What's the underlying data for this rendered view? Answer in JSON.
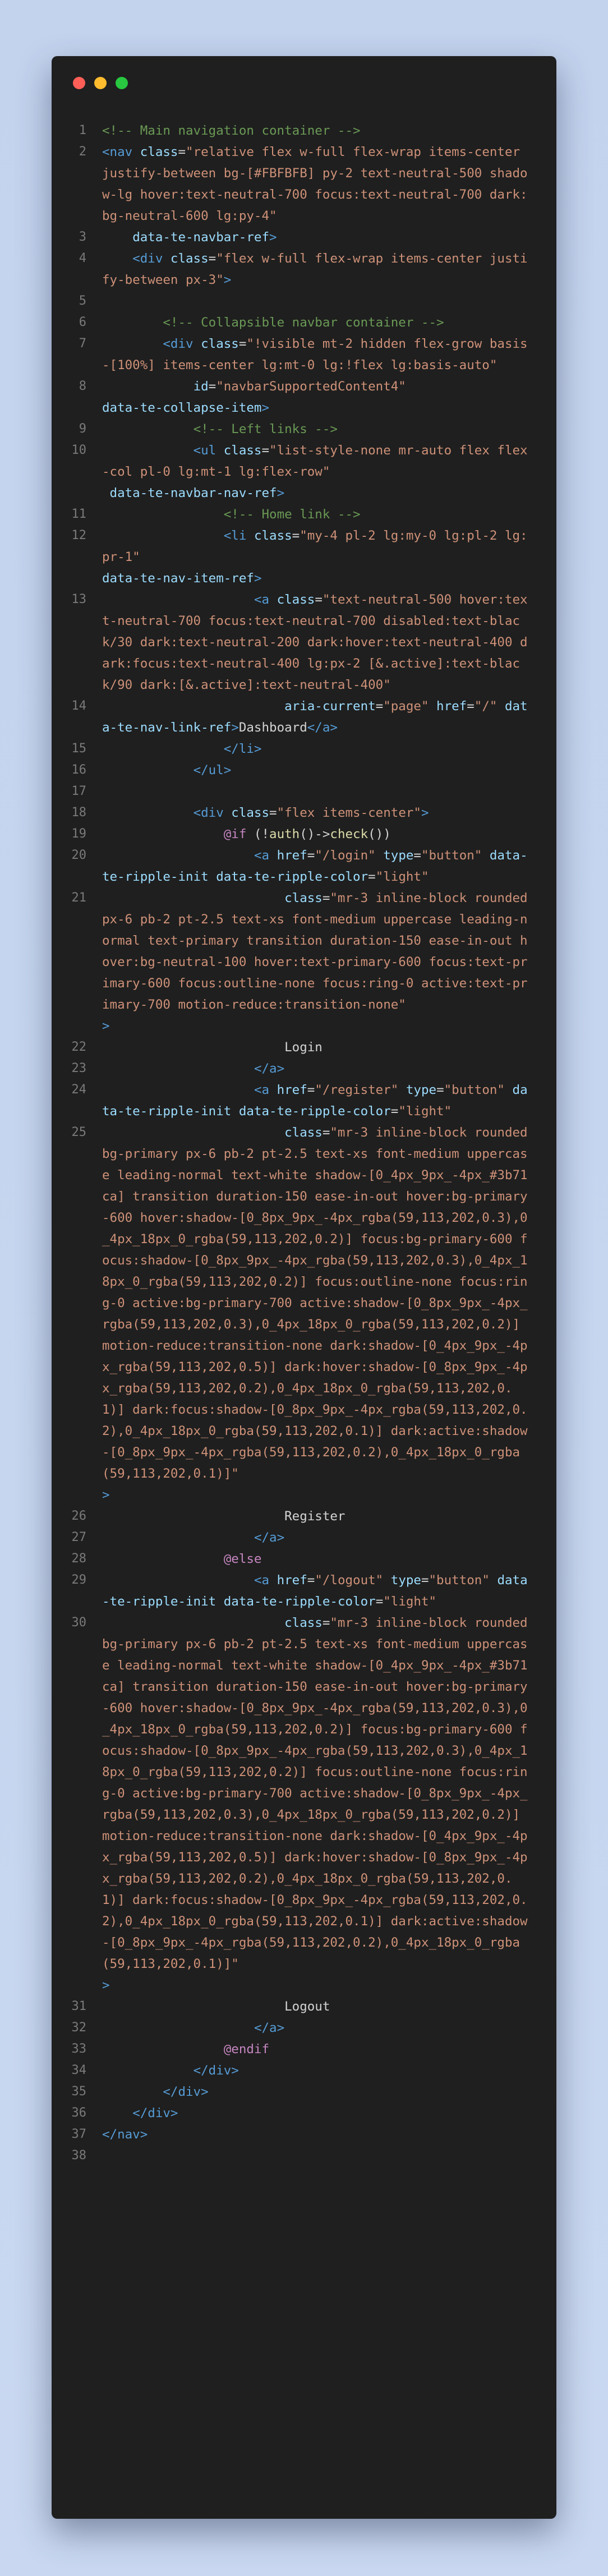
{
  "window": {
    "lines": [
      {
        "n": "1",
        "t": [
          [
            "<!-- Main navigation container -->",
            "cm"
          ]
        ]
      },
      {
        "n": "2",
        "t": [
          [
            "<nav ",
            "tg"
          ],
          [
            "class",
            "at"
          ],
          [
            "=",
            "tx"
          ],
          [
            "\"relative flex w-full flex-wrap items-center justify-between bg-[#FBFBFB] py-2 text-neutral-500 shadow-lg hover:text-neutral-700 focus:text-neutral-700 dark:bg-neutral-600 lg:py-4\"",
            "st"
          ]
        ]
      },
      {
        "n": "3",
        "t": [
          [
            "    ",
            "tx"
          ],
          [
            "data-te-navbar-ref",
            "at"
          ],
          [
            ">",
            "tg"
          ]
        ]
      },
      {
        "n": "4",
        "t": [
          [
            "    ",
            "tx"
          ],
          [
            "<div ",
            "tg"
          ],
          [
            "class",
            "at"
          ],
          [
            "=",
            "tx"
          ],
          [
            "\"flex w-full flex-wrap items-center justify-between px-3\"",
            "st"
          ],
          [
            ">",
            "tg"
          ]
        ]
      },
      {
        "n": "5",
        "t": []
      },
      {
        "n": "6",
        "t": [
          [
            "        ",
            "tx"
          ],
          [
            "<!-- Collapsible navbar container -->",
            "cm"
          ]
        ]
      },
      {
        "n": "7",
        "t": [
          [
            "        ",
            "tx"
          ],
          [
            "<div ",
            "tg"
          ],
          [
            "class",
            "at"
          ],
          [
            "=",
            "tx"
          ],
          [
            "\"!visible mt-2 hidden flex-grow basis-[100%] items-center lg:mt-0 lg:!flex lg:basis-auto\"",
            "st"
          ]
        ]
      },
      {
        "n": "8",
        "t": [
          [
            "            ",
            "tx"
          ],
          [
            "id",
            "at"
          ],
          [
            "=",
            "tx"
          ],
          [
            "\"navbarSupportedContent4\"",
            "st"
          ],
          [
            "\n",
            "tx"
          ],
          [
            "data-te-collapse-item",
            "at"
          ],
          [
            ">",
            "tg"
          ]
        ]
      },
      {
        "n": "9",
        "t": [
          [
            "            ",
            "tx"
          ],
          [
            "<!-- Left links -->",
            "cm"
          ]
        ]
      },
      {
        "n": "10",
        "t": [
          [
            "            ",
            "tx"
          ],
          [
            "<ul ",
            "tg"
          ],
          [
            "class",
            "at"
          ],
          [
            "=",
            "tx"
          ],
          [
            "\"list-style-none mr-auto flex flex-col pl-0 lg:mt-1 lg:flex-row\"",
            "st"
          ],
          [
            "\n ",
            "tx"
          ],
          [
            "data-te-navbar-nav-ref",
            "at"
          ],
          [
            ">",
            "tg"
          ]
        ]
      },
      {
        "n": "11",
        "t": [
          [
            "                ",
            "tx"
          ],
          [
            "<!-- Home link -->",
            "cm"
          ]
        ]
      },
      {
        "n": "12",
        "t": [
          [
            "                ",
            "tx"
          ],
          [
            "<li ",
            "tg"
          ],
          [
            "class",
            "at"
          ],
          [
            "=",
            "tx"
          ],
          [
            "\"my-4 pl-2 lg:my-0 lg:pl-2 lg:pr-1\"",
            "st"
          ],
          [
            "\n",
            "tx"
          ],
          [
            "data-te-nav-item-ref",
            "at"
          ],
          [
            ">",
            "tg"
          ]
        ]
      },
      {
        "n": "13",
        "t": [
          [
            "                    ",
            "tx"
          ],
          [
            "<a ",
            "tg"
          ],
          [
            "class",
            "at"
          ],
          [
            "=",
            "tx"
          ],
          [
            "\"text-neutral-500 hover:text-neutral-700 focus:text-neutral-700 disabled:text-black/30 dark:text-neutral-200 dark:hover:text-neutral-400 dark:focus:text-neutral-400 lg:px-2 [&.active]:text-black/90 dark:[&.active]:text-neutral-400\"",
            "st"
          ]
        ]
      },
      {
        "n": "14",
        "t": [
          [
            "                        ",
            "tx"
          ],
          [
            "aria-current",
            "at"
          ],
          [
            "=",
            "tx"
          ],
          [
            "\"page\"",
            "st"
          ],
          [
            " ",
            "tx"
          ],
          [
            "href",
            "at"
          ],
          [
            "=",
            "tx"
          ],
          [
            "\"/\"",
            "st"
          ],
          [
            " ",
            "tx"
          ],
          [
            "data-te-nav-link-ref",
            "at"
          ],
          [
            ">",
            "tg"
          ],
          [
            "Dashboard",
            "tx"
          ],
          [
            "</a>",
            "tg"
          ]
        ]
      },
      {
        "n": "15",
        "t": [
          [
            "                ",
            "tx"
          ],
          [
            "</li>",
            "tg"
          ]
        ]
      },
      {
        "n": "16",
        "t": [
          [
            "            ",
            "tx"
          ],
          [
            "</ul>",
            "tg"
          ]
        ]
      },
      {
        "n": "17",
        "t": []
      },
      {
        "n": "18",
        "t": [
          [
            "            ",
            "tx"
          ],
          [
            "<div ",
            "tg"
          ],
          [
            "class",
            "at"
          ],
          [
            "=",
            "tx"
          ],
          [
            "\"flex items-center\"",
            "st"
          ],
          [
            ">",
            "tg"
          ]
        ]
      },
      {
        "n": "19",
        "t": [
          [
            "                ",
            "tx"
          ],
          [
            "@if",
            "kw"
          ],
          [
            " (!",
            "tx"
          ],
          [
            "auth",
            "fn"
          ],
          [
            "()->",
            "tx"
          ],
          [
            "check",
            "fn"
          ],
          [
            "())",
            "tx"
          ]
        ]
      },
      {
        "n": "20",
        "t": [
          [
            "                    ",
            "tx"
          ],
          [
            "<a ",
            "tg"
          ],
          [
            "href",
            "at"
          ],
          [
            "=",
            "tx"
          ],
          [
            "\"/login\"",
            "st"
          ],
          [
            " ",
            "tx"
          ],
          [
            "type",
            "at"
          ],
          [
            "=",
            "tx"
          ],
          [
            "\"button\"",
            "st"
          ],
          [
            " ",
            "tx"
          ],
          [
            "data-te-ripple-init",
            "at"
          ],
          [
            " ",
            "tx"
          ],
          [
            "data-te-ripple-color",
            "at"
          ],
          [
            "=",
            "tx"
          ],
          [
            "\"light\"",
            "st"
          ]
        ]
      },
      {
        "n": "21",
        "t": [
          [
            "                        ",
            "tx"
          ],
          [
            "class",
            "at"
          ],
          [
            "=",
            "tx"
          ],
          [
            "\"mr-3 inline-block rounded px-6 pb-2 pt-2.5 text-xs font-medium uppercase leading-normal text-primary transition duration-150 ease-in-out hover:bg-neutral-100 hover:text-primary-600 focus:text-primary-600 focus:outline-none focus:ring-0 active:text-primary-700 motion-reduce:transition-none\"",
            "st"
          ],
          [
            "\n",
            "tx"
          ],
          [
            ">",
            "tg"
          ]
        ]
      },
      {
        "n": "22",
        "t": [
          [
            "                        ",
            "tx"
          ],
          [
            "Login",
            "tx"
          ]
        ]
      },
      {
        "n": "23",
        "t": [
          [
            "                    ",
            "tx"
          ],
          [
            "</a>",
            "tg"
          ]
        ]
      },
      {
        "n": "24",
        "t": [
          [
            "                    ",
            "tx"
          ],
          [
            "<a ",
            "tg"
          ],
          [
            "href",
            "at"
          ],
          [
            "=",
            "tx"
          ],
          [
            "\"/register\"",
            "st"
          ],
          [
            " ",
            "tx"
          ],
          [
            "type",
            "at"
          ],
          [
            "=",
            "tx"
          ],
          [
            "\"button\"",
            "st"
          ],
          [
            " ",
            "tx"
          ],
          [
            "data-te-ripple-init",
            "at"
          ],
          [
            " ",
            "tx"
          ],
          [
            "data-te-ripple-color",
            "at"
          ],
          [
            "=",
            "tx"
          ],
          [
            "\"light\"",
            "st"
          ]
        ]
      },
      {
        "n": "25",
        "t": [
          [
            "                        ",
            "tx"
          ],
          [
            "class",
            "at"
          ],
          [
            "=",
            "tx"
          ],
          [
            "\"mr-3 inline-block rounded bg-primary px-6 pb-2 pt-2.5 text-xs font-medium uppercase leading-normal text-white shadow-[0_4px_9px_-4px_#3b71ca] transition duration-150 ease-in-out hover:bg-primary-600 hover:shadow-[0_8px_9px_-4px_rgba(59,113,202,0.3),0_4px_18px_0_rgba(59,113,202,0.2)] focus:bg-primary-600 focus:shadow-[0_8px_9px_-4px_rgba(59,113,202,0.3),0_4px_18px_0_rgba(59,113,202,0.2)] focus:outline-none focus:ring-0 active:bg-primary-700 active:shadow-[0_8px_9px_-4px_rgba(59,113,202,0.3),0_4px_18px_0_rgba(59,113,202,0.2)] motion-reduce:transition-none dark:shadow-[0_4px_9px_-4px_rgba(59,113,202,0.5)] dark:hover:shadow-[0_8px_9px_-4px_rgba(59,113,202,0.2),0_4px_18px_0_rgba(59,113,202,0.1)] dark:focus:shadow-[0_8px_9px_-4px_rgba(59,113,202,0.2),0_4px_18px_0_rgba(59,113,202,0.1)] dark:active:shadow-[0_8px_9px_-4px_rgba(59,113,202,0.2),0_4px_18px_0_rgba(59,113,202,0.1)]\"",
            "st"
          ],
          [
            "\n",
            "tx"
          ],
          [
            ">",
            "tg"
          ]
        ]
      },
      {
        "n": "26",
        "t": [
          [
            "                        ",
            "tx"
          ],
          [
            "Register",
            "tx"
          ]
        ]
      },
      {
        "n": "27",
        "t": [
          [
            "                    ",
            "tx"
          ],
          [
            "</a>",
            "tg"
          ]
        ]
      },
      {
        "n": "28",
        "t": [
          [
            "                ",
            "tx"
          ],
          [
            "@else",
            "kw"
          ]
        ]
      },
      {
        "n": "29",
        "t": [
          [
            "                    ",
            "tx"
          ],
          [
            "<a ",
            "tg"
          ],
          [
            "href",
            "at"
          ],
          [
            "=",
            "tx"
          ],
          [
            "\"/logout\"",
            "st"
          ],
          [
            " ",
            "tx"
          ],
          [
            "type",
            "at"
          ],
          [
            "=",
            "tx"
          ],
          [
            "\"button\"",
            "st"
          ],
          [
            " ",
            "tx"
          ],
          [
            "data-te-ripple-init",
            "at"
          ],
          [
            " ",
            "tx"
          ],
          [
            "data-te-ripple-color",
            "at"
          ],
          [
            "=",
            "tx"
          ],
          [
            "\"light\"",
            "st"
          ]
        ]
      },
      {
        "n": "30",
        "t": [
          [
            "                        ",
            "tx"
          ],
          [
            "class",
            "at"
          ],
          [
            "=",
            "tx"
          ],
          [
            "\"mr-3 inline-block rounded bg-primary px-6 pb-2 pt-2.5 text-xs font-medium uppercase leading-normal text-white shadow-[0_4px_9px_-4px_#3b71ca] transition duration-150 ease-in-out hover:bg-primary-600 hover:shadow-[0_8px_9px_-4px_rgba(59,113,202,0.3),0_4px_18px_0_rgba(59,113,202,0.2)] focus:bg-primary-600 focus:shadow-[0_8px_9px_-4px_rgba(59,113,202,0.3),0_4px_18px_0_rgba(59,113,202,0.2)] focus:outline-none focus:ring-0 active:bg-primary-700 active:shadow-[0_8px_9px_-4px_rgba(59,113,202,0.3),0_4px_18px_0_rgba(59,113,202,0.2)] motion-reduce:transition-none dark:shadow-[0_4px_9px_-4px_rgba(59,113,202,0.5)] dark:hover:shadow-[0_8px_9px_-4px_rgba(59,113,202,0.2),0_4px_18px_0_rgba(59,113,202,0.1)] dark:focus:shadow-[0_8px_9px_-4px_rgba(59,113,202,0.2),0_4px_18px_0_rgba(59,113,202,0.1)] dark:active:shadow-[0_8px_9px_-4px_rgba(59,113,202,0.2),0_4px_18px_0_rgba(59,113,202,0.1)]\"",
            "st"
          ],
          [
            "\n",
            "tx"
          ],
          [
            ">",
            "tg"
          ]
        ]
      },
      {
        "n": "31",
        "t": [
          [
            "                        ",
            "tx"
          ],
          [
            "Logout",
            "tx"
          ]
        ]
      },
      {
        "n": "32",
        "t": [
          [
            "                    ",
            "tx"
          ],
          [
            "</a>",
            "tg"
          ]
        ]
      },
      {
        "n": "33",
        "t": [
          [
            "                ",
            "tx"
          ],
          [
            "@endif",
            "kw"
          ]
        ]
      },
      {
        "n": "34",
        "t": [
          [
            "            ",
            "tx"
          ],
          [
            "</div>",
            "tg"
          ]
        ]
      },
      {
        "n": "35",
        "t": [
          [
            "        ",
            "tx"
          ],
          [
            "</div>",
            "tg"
          ]
        ]
      },
      {
        "n": "36",
        "t": [
          [
            "    ",
            "tx"
          ],
          [
            "</div>",
            "tg"
          ]
        ]
      },
      {
        "n": "37",
        "t": [
          [
            "</nav>",
            "tg"
          ]
        ]
      },
      {
        "n": "38",
        "t": []
      }
    ]
  }
}
